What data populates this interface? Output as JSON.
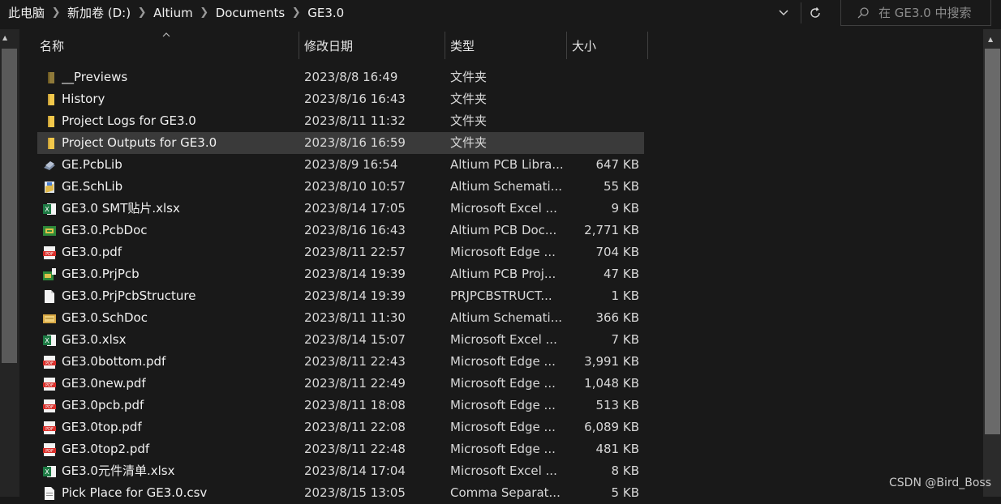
{
  "breadcrumb": [
    "此电脑",
    "新加卷 (D:)",
    "Altium",
    "Documents",
    "GE3.0"
  ],
  "search": {
    "placeholder": "在 GE3.0 中搜索"
  },
  "columns": {
    "name": "名称",
    "date": "修改日期",
    "type": "类型",
    "size": "大小"
  },
  "files": [
    {
      "name": "__Previews",
      "date": "2023/8/8 16:49",
      "type": "文件夹",
      "size": "",
      "icon": "folder-dark-icon"
    },
    {
      "name": "History",
      "date": "2023/8/16 16:43",
      "type": "文件夹",
      "size": "",
      "icon": "folder-icon"
    },
    {
      "name": "Project Logs for GE3.0",
      "date": "2023/8/11 11:32",
      "type": "文件夹",
      "size": "",
      "icon": "folder-icon"
    },
    {
      "name": "Project Outputs for GE3.0",
      "date": "2023/8/16 16:59",
      "type": "文件夹",
      "size": "",
      "icon": "folder-icon",
      "selected": true
    },
    {
      "name": "GE.PcbLib",
      "date": "2023/8/9 16:54",
      "type": "Altium PCB Libra...",
      "size": "647 KB",
      "icon": "pcblib-icon"
    },
    {
      "name": "GE.SchLib",
      "date": "2023/8/10 10:57",
      "type": "Altium Schemati...",
      "size": "55 KB",
      "icon": "schlib-icon"
    },
    {
      "name": "GE3.0 SMT贴片.xlsx",
      "date": "2023/8/14 17:05",
      "type": "Microsoft Excel ...",
      "size": "9 KB",
      "icon": "excel-icon"
    },
    {
      "name": "GE3.0.PcbDoc",
      "date": "2023/8/16 16:43",
      "type": "Altium PCB Doc...",
      "size": "2,771 KB",
      "icon": "pcbdoc-icon"
    },
    {
      "name": "GE3.0.pdf",
      "date": "2023/8/11 22:57",
      "type": "Microsoft Edge ...",
      "size": "704 KB",
      "icon": "pdf-icon"
    },
    {
      "name": "GE3.0.PrjPcb",
      "date": "2023/8/14 19:39",
      "type": "Altium PCB Proj...",
      "size": "47 KB",
      "icon": "prjpcb-icon"
    },
    {
      "name": "GE3.0.PrjPcbStructure",
      "date": "2023/8/14 19:39",
      "type": "PRJPCBSTRUCT...",
      "size": "1 KB",
      "icon": "blank-file-icon"
    },
    {
      "name": "GE3.0.SchDoc",
      "date": "2023/8/11 11:30",
      "type": "Altium Schemati...",
      "size": "366 KB",
      "icon": "schdoc-icon"
    },
    {
      "name": "GE3.0.xlsx",
      "date": "2023/8/14 15:07",
      "type": "Microsoft Excel ...",
      "size": "7 KB",
      "icon": "excel-icon"
    },
    {
      "name": "GE3.0bottom.pdf",
      "date": "2023/8/11 22:43",
      "type": "Microsoft Edge ...",
      "size": "3,991 KB",
      "icon": "pdf-icon"
    },
    {
      "name": "GE3.0new.pdf",
      "date": "2023/8/11 22:49",
      "type": "Microsoft Edge ...",
      "size": "1,048 KB",
      "icon": "pdf-icon"
    },
    {
      "name": "GE3.0pcb.pdf",
      "date": "2023/8/11 18:08",
      "type": "Microsoft Edge ...",
      "size": "513 KB",
      "icon": "pdf-icon"
    },
    {
      "name": "GE3.0top.pdf",
      "date": "2023/8/11 22:08",
      "type": "Microsoft Edge ...",
      "size": "6,089 KB",
      "icon": "pdf-icon"
    },
    {
      "name": "GE3.0top2.pdf",
      "date": "2023/8/11 22:48",
      "type": "Microsoft Edge ...",
      "size": "481 KB",
      "icon": "pdf-icon"
    },
    {
      "name": "GE3.0元件清单.xlsx",
      "date": "2023/8/14 17:04",
      "type": "Microsoft Excel ...",
      "size": "8 KB",
      "icon": "excel-icon"
    },
    {
      "name": "Pick Place for GE3.0.csv",
      "date": "2023/8/15 13:05",
      "type": "Comma Separat...",
      "size": "5 KB",
      "icon": "csv-icon"
    }
  ],
  "watermark": "CSDN @Bird_Boss",
  "colors": {
    "background": "#191919",
    "selected_row": "#3a3a3a",
    "text": "#e8e8e8",
    "folder": "#e8c24a",
    "pdf": "#d9302b",
    "excel": "#1d7a44"
  }
}
